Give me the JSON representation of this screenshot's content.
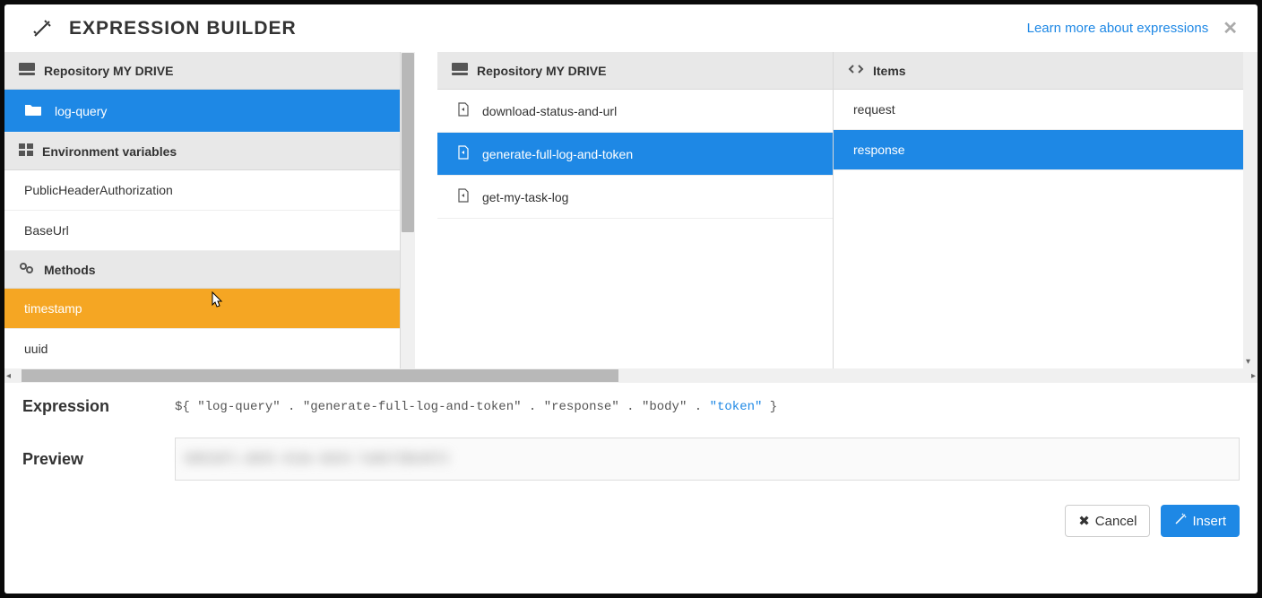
{
  "header": {
    "title": "EXPRESSION BUILDER",
    "learn_link": "Learn more about expressions"
  },
  "col1": {
    "repo_header": "Repository MY DRIVE",
    "repo_items": [
      "log-query"
    ],
    "env_header": "Environment variables",
    "env_items": [
      "PublicHeaderAuthorization",
      "BaseUrl"
    ],
    "methods_header": "Methods",
    "methods_items": [
      "timestamp",
      "uuid"
    ]
  },
  "col2": {
    "header": "Repository MY DRIVE",
    "items": [
      "download-status-and-url",
      "generate-full-log-and-token",
      "get-my-task-log"
    ]
  },
  "col3": {
    "header": "Items",
    "items": [
      "request",
      "response"
    ]
  },
  "expression": {
    "label": "Expression",
    "parts": {
      "p0": "${ ",
      "p1": "\"log-query\"",
      "dot": " . ",
      "p2": "\"generate-full-log-and-token\"",
      "p3": "\"response\"",
      "p4": "\"body\"",
      "p5": "\"token\"",
      "p6": " }"
    }
  },
  "preview": {
    "label": "Preview",
    "value": "6803dF1-d845-42de-8d43-7a0b738b4072"
  },
  "footer": {
    "cancel": "Cancel",
    "insert": "Insert"
  }
}
